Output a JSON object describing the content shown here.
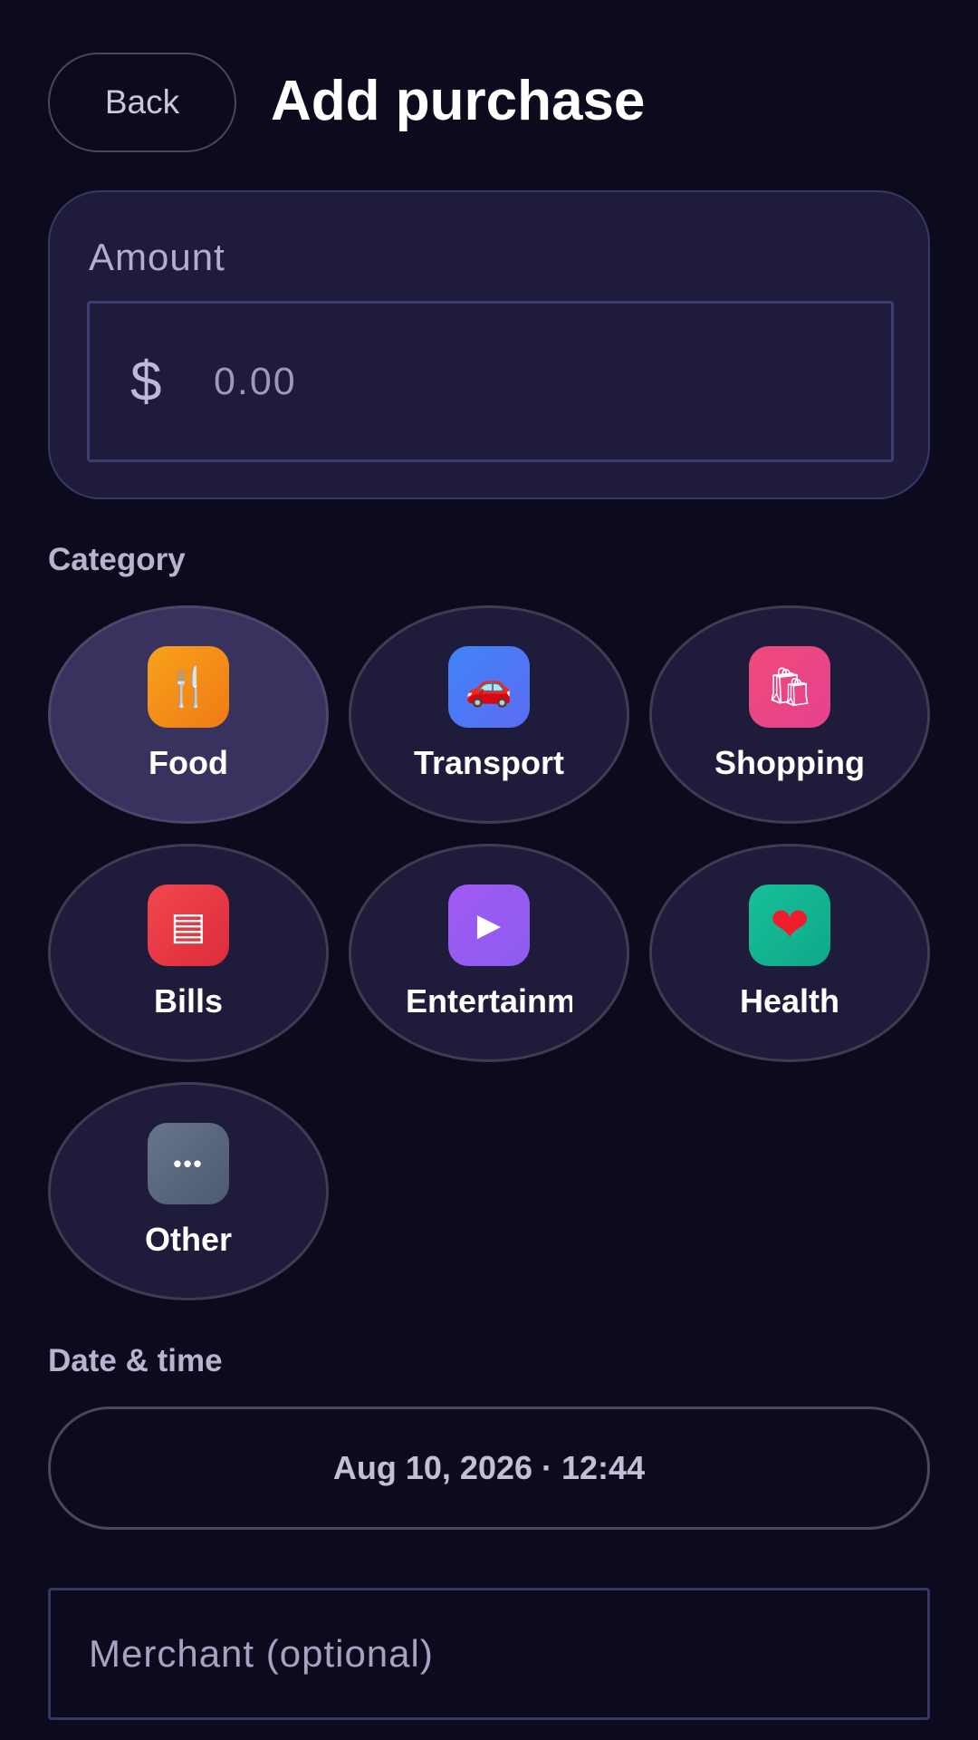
{
  "header": {
    "back_label": "Back",
    "title": "Add purchase"
  },
  "amount": {
    "label": "Amount",
    "currency_symbol": "$",
    "placeholder": "0.00"
  },
  "category": {
    "label": "Category",
    "items": [
      {
        "label": "Food",
        "icon": "fork-knife-icon",
        "glyph": "🍴",
        "color": "#f59e0b",
        "selected": true
      },
      {
        "label": "Transport",
        "icon": "car-icon",
        "glyph": "🚗",
        "color": "#4f7cf6",
        "selected": false
      },
      {
        "label": "Shopping",
        "icon": "shopping-bags-icon",
        "glyph": "🛍",
        "color": "#ec4a86",
        "selected": false
      },
      {
        "label": "Bills",
        "icon": "receipt-icon",
        "glyph": "▤",
        "color": "#ee4248",
        "selected": false
      },
      {
        "label": "Entertainment",
        "icon": "play-icon",
        "glyph": "▶",
        "color": "#9b5cf2",
        "selected": false
      },
      {
        "label": "Health",
        "icon": "heart-icon",
        "glyph": "❤",
        "color": "#14b892",
        "selected": false
      },
      {
        "label": "Other",
        "icon": "more-dots-icon",
        "glyph": "•••",
        "color": "#5e6e86",
        "selected": false
      }
    ]
  },
  "datetime": {
    "label": "Date & time",
    "value": "Aug 10, 2026 · 12:44"
  },
  "merchant": {
    "placeholder": "Merchant (optional)"
  }
}
